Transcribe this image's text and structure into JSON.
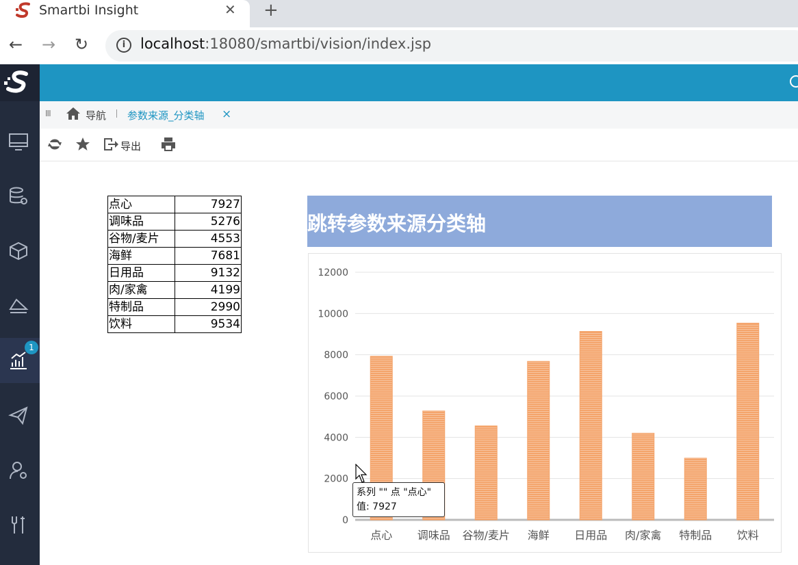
{
  "browser": {
    "tab_title": "Smartbi Insight",
    "close_glyph": "✕",
    "newtab_glyph": "+",
    "url_host": "localhost",
    "url_rest": ":18080/smartbi/vision/index.jsp",
    "back_glyph": "←",
    "forward_glyph": "→",
    "reload_glyph": "↻",
    "info_glyph": "i"
  },
  "sidebar": {
    "badge": "1",
    "items": [
      "monitor-icon",
      "database-settings-icon",
      "cube-icon",
      "layers-icon",
      "analytics-chart-icon",
      "paper-plane-icon",
      "user-settings-icon",
      "tools-icon"
    ],
    "active_index": 4
  },
  "breadcrumb": {
    "grip": "III",
    "nav_label": "导航",
    "tab_label": "参数来源_分类轴",
    "tab_close": "×"
  },
  "actions": {
    "export_label": "导出"
  },
  "table": {
    "rows": [
      {
        "name": "点心",
        "value": "7927"
      },
      {
        "name": "调味品",
        "value": "5276"
      },
      {
        "name": "谷物/麦片",
        "value": "4553"
      },
      {
        "name": "海鲜",
        "value": "7681"
      },
      {
        "name": "日用品",
        "value": "9132"
      },
      {
        "name": "肉/家禽",
        "value": "4199"
      },
      {
        "name": "特制品",
        "value": "2990"
      },
      {
        "name": "饮料",
        "value": "9534"
      }
    ]
  },
  "chart_title": "跳转参数来源分类轴",
  "chart_data": {
    "type": "bar",
    "title": "跳转参数来源分类轴",
    "categories": [
      "点心",
      "调味品",
      "谷物/麦片",
      "海鲜",
      "日用品",
      "肉/家禽",
      "特制品",
      "饮料"
    ],
    "values": [
      7927,
      5276,
      4553,
      7681,
      9132,
      4199,
      2990,
      9534
    ],
    "ylim": [
      0,
      12000
    ],
    "yticks": [
      0,
      2000,
      4000,
      6000,
      8000,
      10000,
      12000
    ],
    "grid": true,
    "bar_color": "#f4a46b",
    "xlabel": "",
    "ylabel": ""
  },
  "tooltip": {
    "line1": "系列 \"\" 点 \"点心\"",
    "line2": "值: 7927"
  },
  "colors": {
    "brand_blue": "#1e95c2",
    "sidebar_dark": "#232c3d",
    "title_bg": "#8eaadb",
    "bar": "#f4a46b"
  }
}
